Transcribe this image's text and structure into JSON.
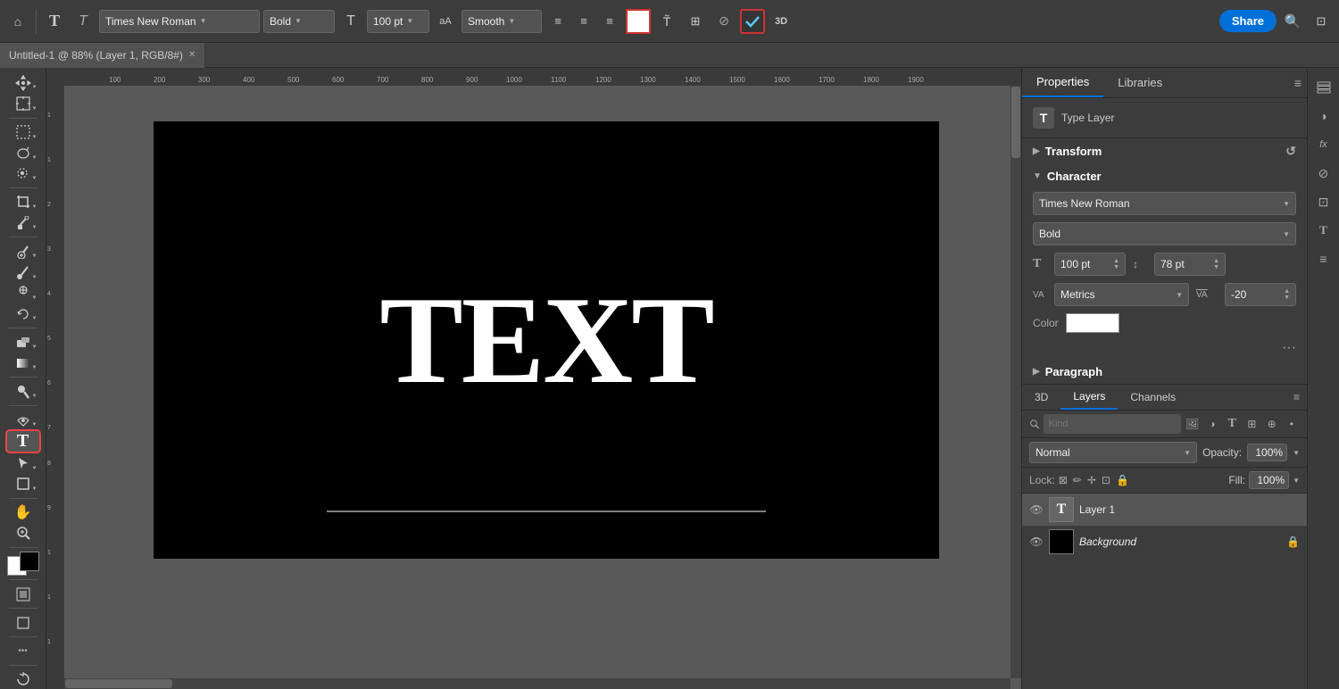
{
  "toolbar": {
    "home_icon": "⌂",
    "type_tool_label": "T",
    "type_tool2_label": "T",
    "font_family": "Times New Roman",
    "font_style": "Bold",
    "font_size_icon": "T",
    "font_size": "100 pt",
    "aa_icon": "aA",
    "anti_alias": "Smooth",
    "align_left": "≡",
    "align_center": "≡",
    "align_right": "≡",
    "color_white": "#ffffff",
    "warp_icon": "T",
    "toggle_icon": "≡",
    "cancel_icon": "⊘",
    "commit_icon": "✓",
    "three_d": "3D",
    "share_label": "Share",
    "search_icon": "🔍",
    "expand_icon": "⊡"
  },
  "document": {
    "tab_title": "Untitled-1 @ 88% (Layer 1, RGB/8#)",
    "canvas_text": "TEXT"
  },
  "left_tools": [
    {
      "name": "move",
      "icon": "✛"
    },
    {
      "name": "select-artboard",
      "icon": "⊡"
    },
    {
      "name": "lasso",
      "icon": "∿"
    },
    {
      "name": "crop",
      "icon": "⌗"
    },
    {
      "name": "eyedropper",
      "icon": "⊘"
    },
    {
      "name": "spot-heal",
      "icon": "⊕"
    },
    {
      "name": "brush",
      "icon": "/"
    },
    {
      "name": "clone",
      "icon": "⊕"
    },
    {
      "name": "eraser",
      "icon": "◻"
    },
    {
      "name": "gradient",
      "icon": "◼"
    },
    {
      "name": "dodge",
      "icon": "○"
    },
    {
      "name": "pen",
      "icon": "✒"
    },
    {
      "name": "type",
      "icon": "T"
    },
    {
      "name": "path-select",
      "icon": "↖"
    },
    {
      "name": "shape",
      "icon": "◻"
    },
    {
      "name": "hand",
      "icon": "✋"
    },
    {
      "name": "zoom",
      "icon": "⊕"
    }
  ],
  "properties_panel": {
    "tab_properties": "Properties",
    "tab_libraries": "Libraries",
    "type_layer_label": "Type Layer",
    "transform_label": "Transform",
    "character_label": "Character",
    "font_family_value": "Times New Roman",
    "font_style_value": "Bold",
    "font_size_label": "T",
    "font_size_value": "100 pt",
    "leading_label": "↕",
    "leading_value": "78 pt",
    "kerning_label": "VA",
    "kerning_value": "Metrics",
    "tracking_label": "VA",
    "tracking_value": "-20",
    "color_label": "Color",
    "color_value": "#ffffff",
    "more_label": "...",
    "paragraph_label": "Paragraph"
  },
  "layers_panel": {
    "tab_3d": "3D",
    "tab_layers": "Layers",
    "tab_channels": "Channels",
    "search_placeholder": "Kind",
    "blend_mode": "Normal",
    "opacity_label": "Opacity:",
    "opacity_value": "100%",
    "lock_label": "Lock:",
    "fill_label": "Fill:",
    "fill_value": "100%",
    "layers": [
      {
        "name": "Layer 1",
        "type": "text",
        "visible": true
      },
      {
        "name": "Background",
        "type": "image",
        "visible": true,
        "locked": true
      }
    ]
  },
  "ruler": {
    "h_ticks": [
      "100",
      "200",
      "300",
      "400",
      "500",
      "600",
      "700",
      "800",
      "900",
      "1000",
      "1100",
      "1200",
      "1300",
      "1400",
      "1500",
      "1600",
      "1700",
      "1800",
      "1900"
    ],
    "v_ticks": [
      "1",
      "1",
      "2",
      "3",
      "4",
      "5",
      "6",
      "7",
      "8",
      "9",
      "1",
      "1",
      "1",
      "1"
    ]
  }
}
